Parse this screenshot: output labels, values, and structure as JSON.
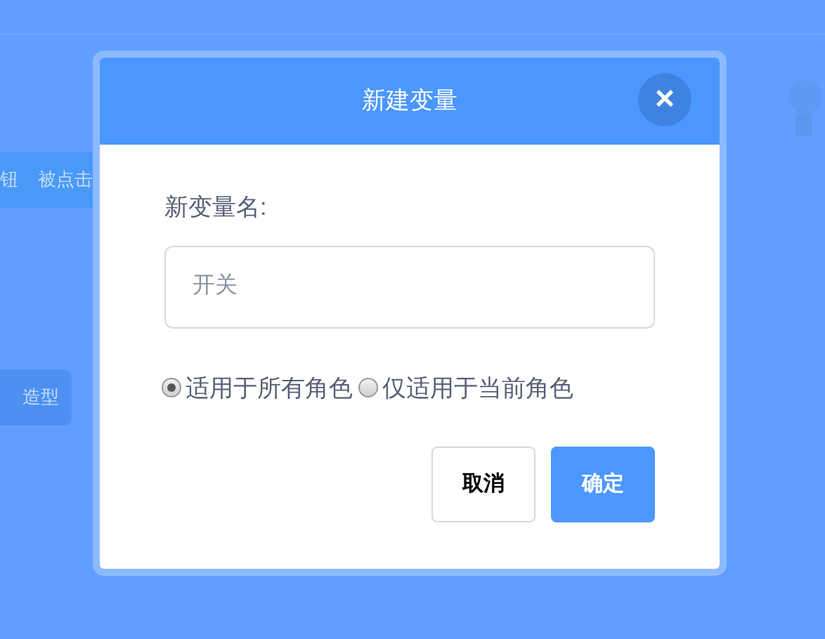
{
  "background": {
    "blocks": [
      {
        "texts": [
          "钮",
          "被点击"
        ]
      },
      {
        "texts": [
          "造型"
        ]
      }
    ]
  },
  "dialog": {
    "title": "新建变量",
    "close": "×",
    "field_label": "新变量名:",
    "field": {
      "placeholder": "开关"
    },
    "scope_options": [
      {
        "label": "适用于所有角色",
        "selected": true
      },
      {
        "label": "仅适用于当前角色",
        "selected": false
      }
    ],
    "buttons": [
      {
        "label": "取消",
        "kind": "secondary"
      },
      {
        "label": "确定",
        "kind": "primary"
      }
    ]
  }
}
